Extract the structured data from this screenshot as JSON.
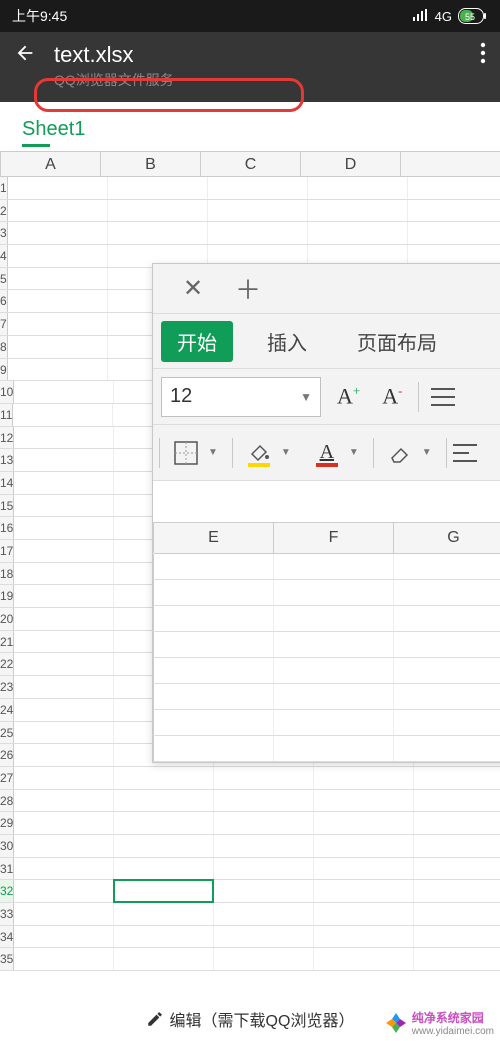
{
  "statusbar": {
    "time": "上午9:45",
    "network": "4G",
    "battery": "55"
  },
  "header": {
    "title": "text.xlsx",
    "subtitle": "QQ浏览器文件服务"
  },
  "sheettabs": [
    {
      "label": "Sheet1"
    }
  ],
  "columns": [
    "A",
    "B",
    "C",
    "D"
  ],
  "rows": [
    "1",
    "2",
    "3",
    "4",
    "5",
    "6",
    "7",
    "8",
    "9",
    "10",
    "11",
    "12",
    "13",
    "14",
    "15",
    "16",
    "17",
    "18",
    "19",
    "20",
    "21",
    "22",
    "23",
    "24",
    "25",
    "26",
    "27",
    "28",
    "29",
    "30",
    "31",
    "32",
    "33",
    "34",
    "35"
  ],
  "active_cell": {
    "row": 32,
    "col": "B"
  },
  "overlay": {
    "ribbon_tabs": {
      "start": "开始",
      "insert": "插入",
      "pagelayout": "页面布局"
    },
    "font_size": "12",
    "columns": [
      "E",
      "F",
      "G"
    ]
  },
  "bottombar": {
    "label": "编辑（需下载QQ浏览器）"
  },
  "watermark": {
    "text": "纯净系统家园",
    "url": "www.yidaimei.com"
  }
}
